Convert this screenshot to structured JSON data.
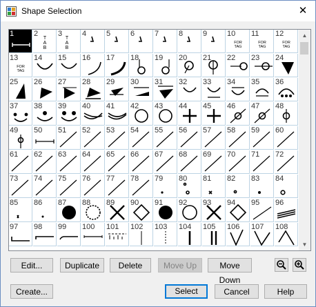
{
  "window": {
    "title": "Shape Selection",
    "close_glyph": "✕"
  },
  "grid": {
    "cells": [
      "1",
      "2",
      "3",
      "4",
      "5",
      "6",
      "7",
      "8",
      "9",
      "10",
      "11",
      "12",
      "13",
      "14",
      "15",
      "16",
      "17",
      "18",
      "19",
      "20",
      "21",
      "22",
      "23",
      "24",
      "25",
      "26",
      "27",
      "28",
      "29",
      "30",
      "31",
      "32",
      "33",
      "34",
      "35",
      "36",
      "37",
      "38",
      "39",
      "40",
      "41",
      "42",
      "43",
      "44",
      "45",
      "46",
      "47",
      "48",
      "49",
      "50",
      "51",
      "52",
      "53",
      "54",
      "55",
      "56",
      "57",
      "58",
      "59",
      "60",
      "61",
      "62",
      "63",
      "64",
      "65",
      "66",
      "67",
      "68",
      "69",
      "70",
      "71",
      "72",
      "73",
      "74",
      "75",
      "76",
      "77",
      "78",
      "79",
      "80",
      "81",
      "82",
      "83",
      "84",
      "85",
      "86",
      "87",
      "88",
      "89",
      "90",
      "91",
      "92",
      "93",
      "94",
      "95",
      "96",
      "97",
      "98",
      "99",
      "100",
      "101",
      "102",
      "103",
      "104",
      "105",
      "106",
      "107",
      "108"
    ],
    "selected": "1",
    "tab_label": "T\nA\nB",
    "for_tag_label": "FOR\nTAG"
  },
  "buttons": {
    "edit": "Edit...",
    "duplicate": "Duplicate",
    "delete": "Delete",
    "move_up": "Move Up",
    "move_down": "Move Down",
    "create": "Create...",
    "select": "Select",
    "cancel": "Cancel",
    "help": "Help"
  },
  "icons": {
    "app": "shape-selection-app-icon",
    "zoom_out": "zoom-out-icon",
    "zoom_in": "zoom-in-icon",
    "scroll_up": "scroll-up-arrow-icon",
    "scroll_down": "scroll-down-arrow-icon"
  }
}
